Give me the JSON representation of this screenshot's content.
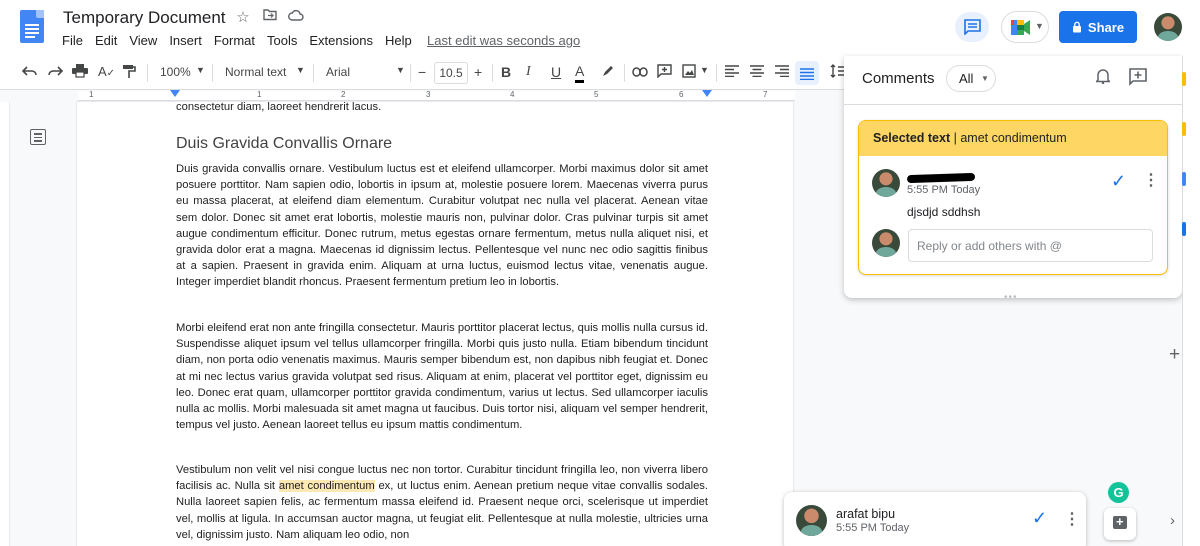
{
  "header": {
    "title": "Temporary Document",
    "menu": [
      "File",
      "Edit",
      "View",
      "Insert",
      "Format",
      "Tools",
      "Extensions",
      "Help"
    ],
    "last_edit": "Last edit was seconds ago",
    "share_label": "Share"
  },
  "toolbar": {
    "zoom": "100%",
    "style": "Normal text",
    "font": "Arial",
    "font_size": "10.5",
    "minus": "−",
    "plus": "+",
    "bold": "B",
    "italic": "I",
    "underline": "U",
    "text_color": "A"
  },
  "ruler": {
    "numbers": [
      "1",
      "1",
      "2",
      "3",
      "4",
      "5",
      "6",
      "7"
    ]
  },
  "document": {
    "top_line": "consectetur diam, laoreet hendrerit lacus.",
    "heading": "Duis Gravida Convallis Ornare",
    "para1": "Duis gravida convallis ornare. Vestibulum luctus est et eleifend ullamcorper. Morbi maximus dolor sit amet posuere porttitor. Nam sapien odio, lobortis in ipsum at, molestie posuere lorem. Maecenas viverra purus eu massa placerat, at eleifend diam elementum. Curabitur volutpat nec nulla vel placerat. Aenean vitae sem dolor. Donec sit amet erat lobortis, molestie mauris non, pulvinar dolor. Cras pulvinar turpis sit amet augue condimentum efficitur. Donec rutrum, metus egestas ornare fermentum, metus nulla aliquet nisi, et gravida dolor erat a magna. Maecenas id dignissim lectus. Pellentesque vel nunc nec odio sagittis finibus at a sapien. Praesent in gravida enim. Aliquam at urna luctus, euismod lectus vitae, venenatis augue. Integer imperdiet blandit rhoncus. Praesent fermentum pretium leo in lobortis.",
    "para2": "Morbi eleifend erat non ante fringilla consectetur. Mauris porttitor placerat lectus, quis mollis nulla cursus id. Suspendisse aliquet ipsum vel tellus ullamcorper fringilla. Morbi quis justo nulla. Etiam bibendum tincidunt diam, non porta odio venenatis maximus. Mauris semper bibendum est, non dapibus nibh feugiat et. Donec at mi nec lectus varius gravida volutpat sed risus. Aliquam at enim, placerat vel porttitor eget, dignissim eu leo. Donec erat quam, ullamcorper porttitor gravida condimentum, varius ut lectus. Sed ullamcorper iaculis nulla ac mollis. Morbi malesuada sit amet magna ut faucibus. Duis tortor nisi, aliquam vel semper hendrerit, tempus vel justo. Aenean laoreet tellus eu ipsum mattis condimentum.",
    "para3_before": "Vestibulum non velit vel nisi congue luctus nec non tortor. Curabitur tincidunt fringilla leo, non viverra libero facilisis ac. Nulla sit ",
    "para3_highlight": "amet condimentum",
    "para3_after": " ex, ut luctus enim. Aenean pretium neque vitae convallis sodales. Nulla laoreet sapien felis, ac fermentum massa eleifend id. Praesent neque orci, scelerisque ut imperdiet vel, mollis at ligula. In accumsan auctor magna, ut feugiat elit. Pellentesque at nulla molestie, ultricies urna vel, dignissim justo. Nam aliquam leo odio, non"
  },
  "comments_panel": {
    "title": "Comments",
    "filter": "All",
    "card": {
      "selected_label": "Selected text",
      "selected_text": "amet condimentum",
      "time": "5:55 PM Today",
      "comment": "djsdjd sddhsh",
      "reply_placeholder": "Reply or add others with @"
    }
  },
  "bottom_comment": {
    "author": "arafat bipu",
    "time": "5:55 PM Today"
  },
  "colors": {
    "accent": "#1a73e8",
    "highlight": "#fce8b2",
    "card_header": "#fdd663"
  }
}
